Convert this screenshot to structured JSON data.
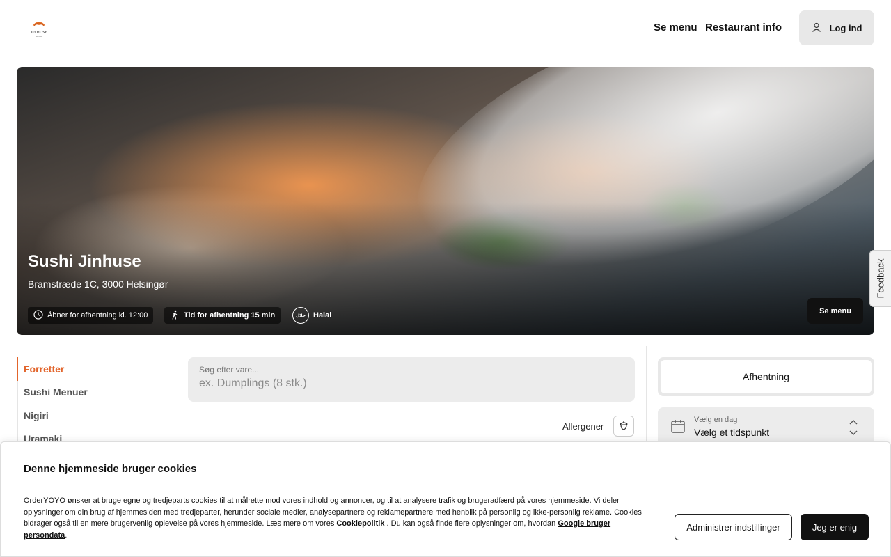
{
  "header": {
    "logo_text": "JINHUSE",
    "nav": [
      "Se menu",
      "Restaurant info"
    ],
    "login_label": "Log ind",
    "login_icon": "user-icon"
  },
  "hero": {
    "title": "Sushi Jinhuse",
    "address": "Bramstræde 1C, 3000 Helsingør",
    "open_text": "Åbner for afhentning kl. 12:00",
    "pickup_time_text": "Tid for afhentning 15 min",
    "halal_label": "Halal",
    "menu_button": "Se menu"
  },
  "feedback_label": "Feedback",
  "categories": [
    "Forretter",
    "Sushi Menuer",
    "Nigiri",
    "Uramaki"
  ],
  "search": {
    "label": "Søg efter vare...",
    "placeholder": "ex. Dumplings (8 stk.)"
  },
  "allergen_label": "Allergener",
  "order": {
    "mode": "Afhentning",
    "day_label": "Vælg en dag",
    "time_label": "Vælg et tidspunkt"
  },
  "cookie": {
    "title": "Denne hjemmeside bruger cookies",
    "text_1": "OrderYOYO ønsker at bruge egne og tredjeparts cookies til at målrette mod vores indhold og annoncer, og til at analysere trafik og brugeradfærd på vores hjemmeside. Vi deler oplysninger om din brug af hjemmesiden med tredjeparter, herunder sociale medier, analysepartnere og reklamepartnere med henblik på personlig og ikke-personlig reklame. Cookies bidrager også til en mere brugervenlig oplevelse på vores hjemmeside. Læs mere om vores ",
    "link_1": "Cookiepolitik",
    "text_2": " . Du kan også finde flere oplysninger om, hvordan ",
    "link_2": "Google bruger persondata",
    "text_3": ".",
    "manage_button": "Administrer indstillinger",
    "accept_button": "Jeg er enig"
  },
  "colors": {
    "accent": "#e2652c",
    "dark_button": "#111111"
  }
}
